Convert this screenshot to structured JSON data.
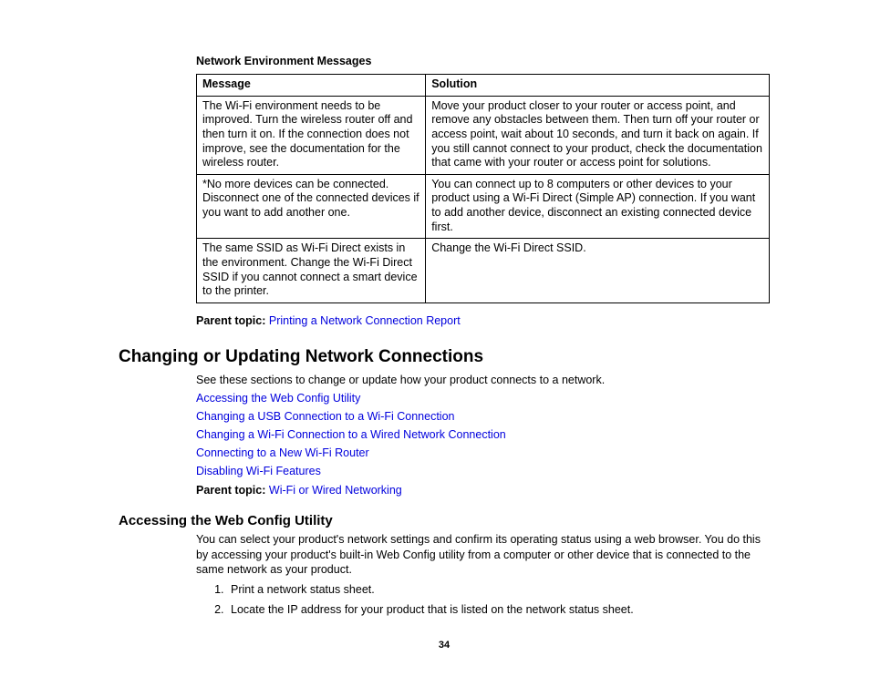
{
  "tableHeader": "Network Environment Messages",
  "table": {
    "columns": [
      "Message",
      "Solution"
    ],
    "rows": [
      {
        "message": "The Wi-Fi environment needs to be improved. Turn the wireless router off and then turn it on. If the connection does not improve, see the documentation for the wireless router.",
        "solution": "Move your product closer to your router or access point, and remove any obstacles between them. Then turn off your router or access point, wait about 10 seconds, and turn it back on again. If you still cannot connect to your product, check the documentation that came with your router or access point for solutions."
      },
      {
        "message": "*No more devices can be connected. Disconnect one of the connected devices if you want to add another one.",
        "solution": "You can connect up to 8 computers or other devices to your product using a Wi-Fi Direct (Simple AP) connection. If you want to add another device, disconnect an existing connected device first."
      },
      {
        "message": "The same SSID as Wi-Fi Direct exists in the environment. Change the Wi-Fi Direct SSID if you cannot connect a smart device to the printer.",
        "solution": "Change the Wi-Fi Direct SSID."
      }
    ]
  },
  "parentTopic1": {
    "label": "Parent topic:",
    "link": "Printing a Network Connection Report"
  },
  "sectionTitle": "Changing or Updating Network Connections",
  "sectionIntro": "See these sections to change or update how your product connects to a network.",
  "links": [
    "Accessing the Web Config Utility",
    "Changing a USB Connection to a Wi-Fi Connection",
    "Changing a Wi-Fi Connection to a Wired Network Connection",
    "Connecting to a New Wi-Fi Router",
    "Disabling Wi-Fi Features"
  ],
  "parentTopic2": {
    "label": "Parent topic:",
    "link": "Wi-Fi or Wired Networking"
  },
  "subsectionTitle": "Accessing the Web Config Utility",
  "subsectionText": "You can select your product's network settings and confirm its operating status using a web browser. You do this by accessing your product's built-in Web Config utility from a computer or other device that is connected to the same network as your product.",
  "steps": [
    "Print a network status sheet.",
    "Locate the IP address for your product that is listed on the network status sheet."
  ],
  "pageNumber": "34"
}
